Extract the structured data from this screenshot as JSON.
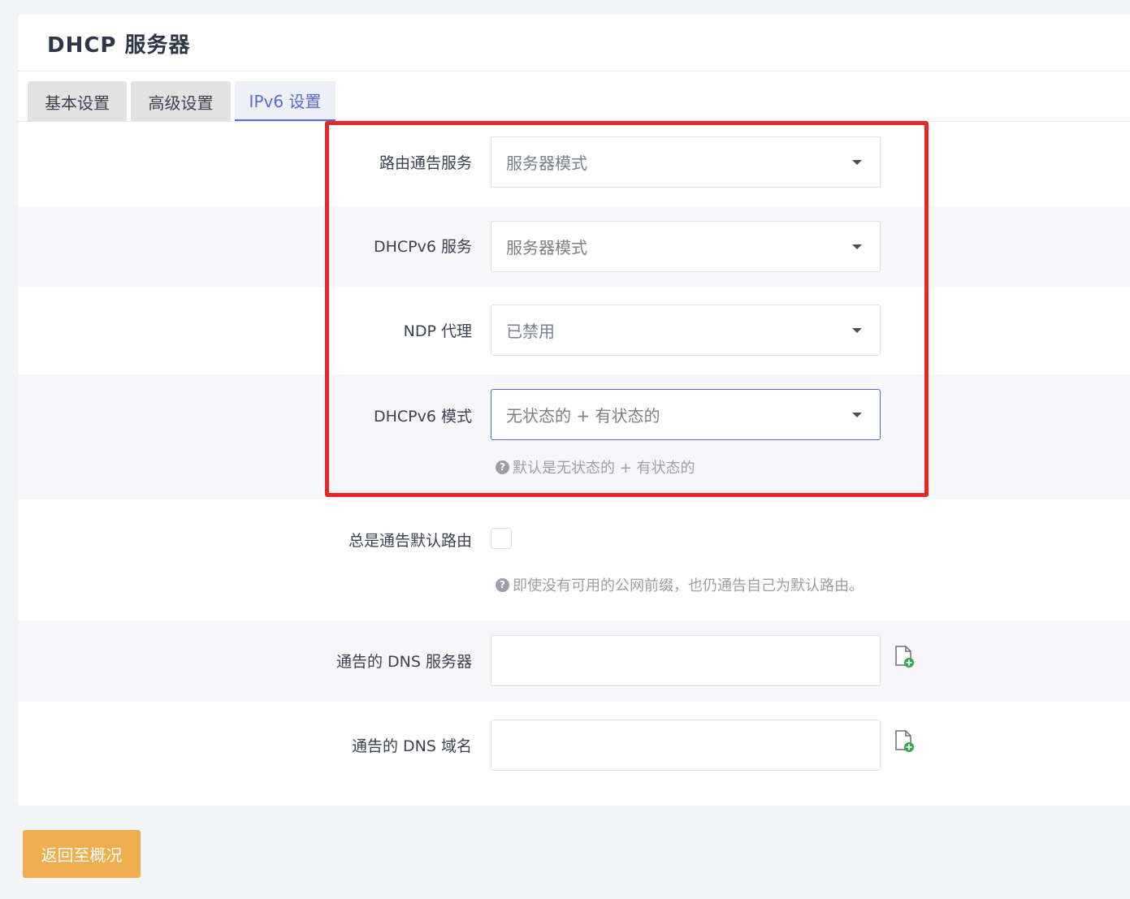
{
  "page": {
    "title": "DHCP 服务器"
  },
  "tabs": [
    {
      "label": "基本设置"
    },
    {
      "label": "高级设置"
    },
    {
      "label": "IPv6 设置"
    }
  ],
  "fields": {
    "ra_service": {
      "label": "路由通告服务",
      "value": "服务器模式"
    },
    "dhcpv6_service": {
      "label": "DHCPv6 服务",
      "value": "服务器模式"
    },
    "ndp_proxy": {
      "label": "NDP 代理",
      "value": "已禁用"
    },
    "dhcpv6_mode": {
      "label": "DHCPv6 模式",
      "value": "无状态的 + 有状态的",
      "hint": "默认是无状态的 + 有状态的"
    },
    "always_default_route": {
      "label": "总是通告默认路由",
      "hint": "即使没有可用的公网前缀，也仍通告自己为默认路由。"
    },
    "dns_servers": {
      "label": "通告的 DNS 服务器",
      "value": ""
    },
    "dns_domains": {
      "label": "通告的 DNS 域名",
      "value": ""
    }
  },
  "footer": {
    "back_label": "返回至概况"
  },
  "colors": {
    "accent": "#5b6ad1",
    "highlight": "#e8262a",
    "back_button": "#f0ad4e"
  },
  "icons": {
    "hint": "question-circle-icon",
    "add": "add-file-icon",
    "dropdown": "caret-down-icon"
  }
}
